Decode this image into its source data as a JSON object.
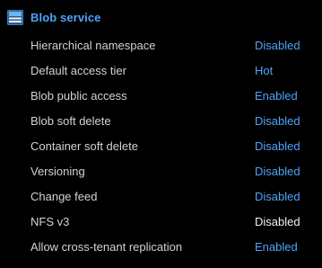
{
  "section": {
    "title": "Blob service",
    "icon": "blob-storage-icon",
    "accent_color": "#4fa3f7"
  },
  "rows": [
    {
      "label": "Hierarchical namespace",
      "value": "Disabled",
      "link": true
    },
    {
      "label": "Default access tier",
      "value": "Hot",
      "link": true
    },
    {
      "label": "Blob public access",
      "value": "Enabled",
      "link": true
    },
    {
      "label": "Blob soft delete",
      "value": "Disabled",
      "link": true
    },
    {
      "label": "Container soft delete",
      "value": "Disabled",
      "link": true
    },
    {
      "label": "Versioning",
      "value": "Disabled",
      "link": true
    },
    {
      "label": "Change feed",
      "value": "Disabled",
      "link": true
    },
    {
      "label": "NFS v3",
      "value": "Disabled",
      "link": false
    },
    {
      "label": "Allow cross-tenant replication",
      "value": "Enabled",
      "link": true
    }
  ]
}
